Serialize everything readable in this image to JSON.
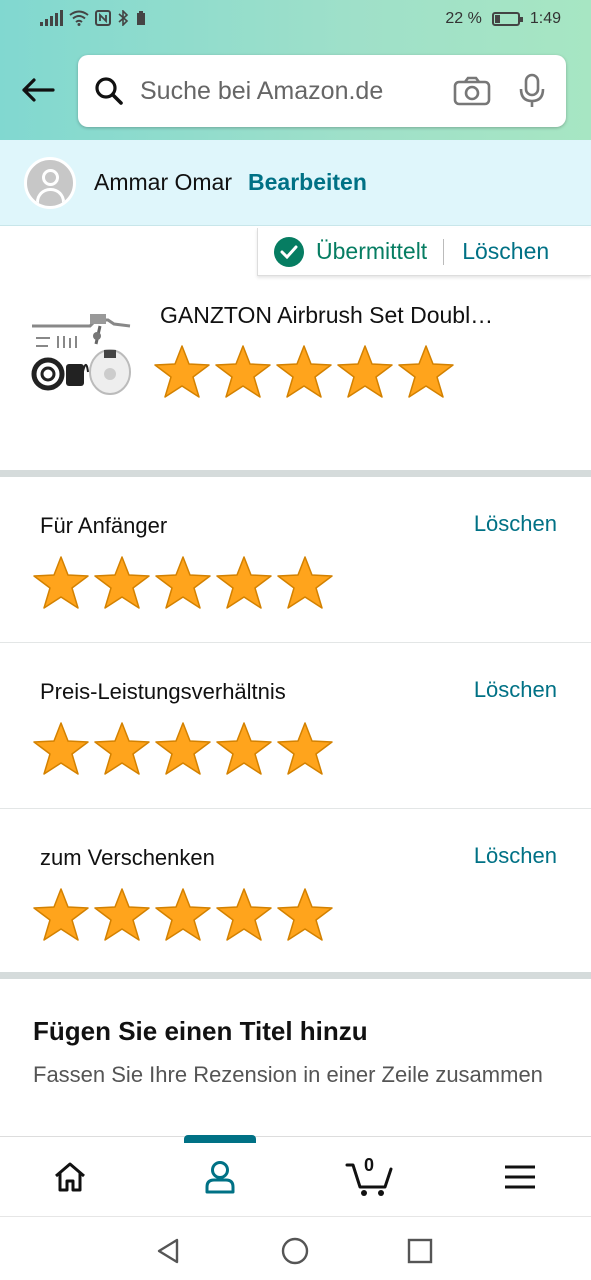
{
  "status_bar": {
    "battery": "22 %",
    "time": "1:49",
    "battery_level": 0.22
  },
  "search": {
    "placeholder": "Suche bei Amazon.de"
  },
  "profile": {
    "name": "Ammar Omar",
    "edit_label": "Bearbeiten"
  },
  "submission": {
    "status_label": "Übermittelt",
    "delete_label": "Löschen"
  },
  "product": {
    "title": "GANZTON Airbrush Set Doubl…",
    "rating": 5,
    "max_rating": 5
  },
  "attributes": [
    {
      "label": "Für Anfänger",
      "delete_label": "Löschen",
      "rating": 5
    },
    {
      "label": "Preis-Leistungsverhältnis",
      "delete_label": "Löschen",
      "rating": 5
    },
    {
      "label": "zum Verschenken",
      "delete_label": "Löschen",
      "rating": 5
    }
  ],
  "title_section": {
    "heading": "Fügen Sie einen Titel hinzu",
    "hint": "Fassen Sie Ihre Rezension in einer Zeile zusammen"
  },
  "bottom_nav": {
    "items": [
      {
        "icon": "home-icon"
      },
      {
        "icon": "account-icon",
        "active": true
      },
      {
        "icon": "cart-icon"
      },
      {
        "icon": "menu-icon"
      }
    ],
    "cart_count": "0"
  },
  "colors": {
    "accent": "#007185",
    "success": "#067d62",
    "star": "#ffa41c",
    "star_outline": "#d38100"
  }
}
